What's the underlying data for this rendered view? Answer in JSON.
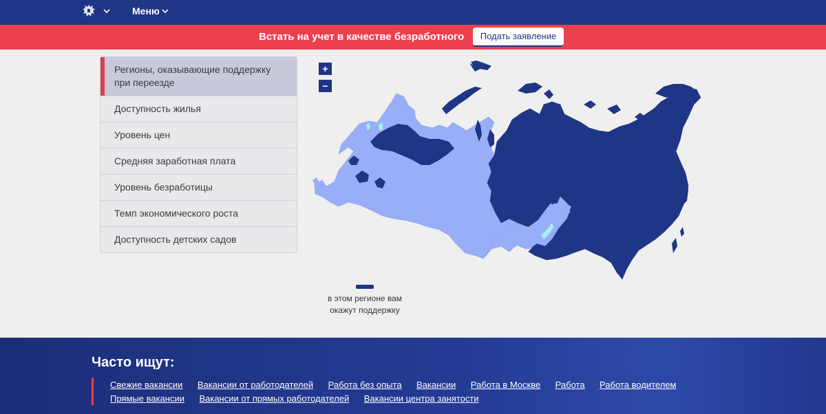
{
  "header": {
    "emblem_icon": "coat-of-arms-icon",
    "menu_label": "Меню"
  },
  "promo": {
    "text": "Встать на учет в качестве безработного",
    "button_label": "Подать заявление"
  },
  "sidebar": {
    "items": [
      {
        "label": "Регионы, оказывающие поддержку при переезде",
        "active": true
      },
      {
        "label": "Доступность жилья"
      },
      {
        "label": "Уровень цен"
      },
      {
        "label": "Средняя заработная плата"
      },
      {
        "label": "Уровень безработицы"
      },
      {
        "label": "Темп экономического роста"
      },
      {
        "label": "Доступность детских садов"
      }
    ]
  },
  "map": {
    "zoom_in_label": "+",
    "zoom_out_label": "−",
    "legend_text": "в этом регионе вам окажут поддержку",
    "colors": {
      "support": "#1f3585",
      "other": "#99aef9",
      "highlight": "#a6f0f0"
    }
  },
  "footer": {
    "title": "Часто ищут:",
    "links_row1": [
      "Свежие вакансии",
      "Вакансии от работодателей",
      "Работа без опыта",
      "Вакансии",
      "Работа в Москве",
      "Работа",
      "Работа водителем"
    ],
    "links_row2": [
      "Прямые вакансии",
      "Вакансии от прямых работодателей",
      "Вакансии центра занятости"
    ]
  }
}
